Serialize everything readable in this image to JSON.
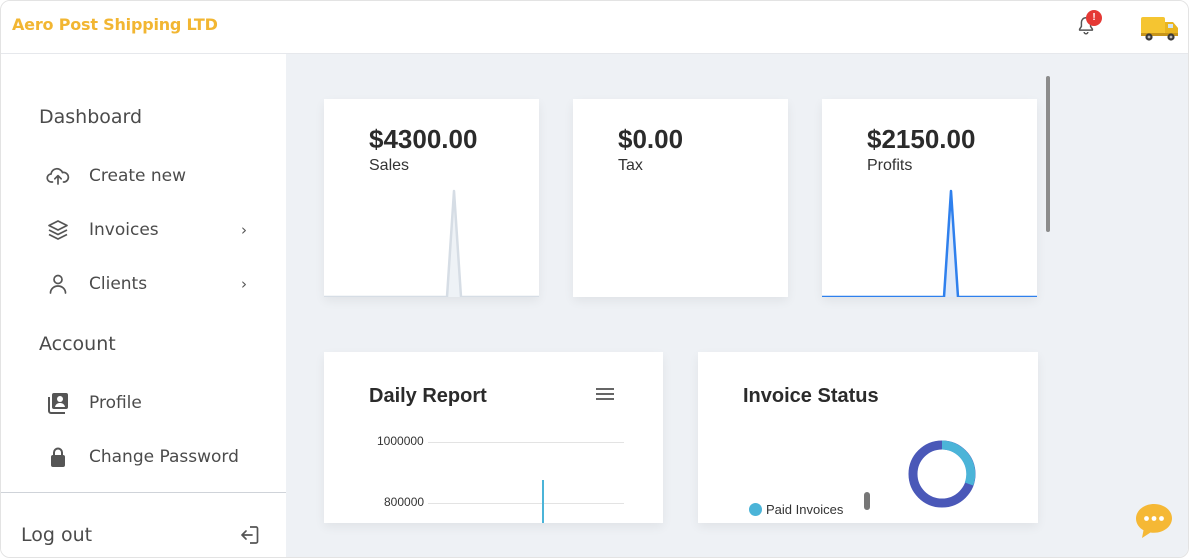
{
  "header": {
    "brand": "Aero Post Shipping LTD",
    "notification_count": "!",
    "brand_color": "#f2b632"
  },
  "sidebar": {
    "sections": [
      {
        "title": "Dashboard",
        "items": [
          {
            "label": "Create new",
            "icon": "cloud-upload-icon"
          },
          {
            "label": "Invoices",
            "icon": "layers-icon",
            "has_submenu": true
          },
          {
            "label": "Clients",
            "icon": "user-icon",
            "has_submenu": true
          }
        ]
      },
      {
        "title": "Account",
        "items": [
          {
            "label": "Profile",
            "icon": "profile-card-icon"
          },
          {
            "label": "Change Password",
            "icon": "lock-icon"
          }
        ]
      }
    ],
    "logout_label": "Log out",
    "chevron": "›"
  },
  "stats": [
    {
      "value": "$4300.00",
      "label": "Sales"
    },
    {
      "value": "$0.00",
      "label": "Tax"
    },
    {
      "value": "$2150.00",
      "label": "Profits"
    }
  ],
  "daily_report": {
    "title": "Daily Report",
    "menu_icon": "hamburger-menu-icon",
    "chart_data": {
      "type": "bar",
      "y_ticks": [
        "1000000",
        "800000"
      ],
      "series_color": "#4bb4d8"
    }
  },
  "invoice_status": {
    "title": "Invoice Status",
    "chart_data": {
      "type": "pie",
      "legend": [
        "Paid Invoices"
      ],
      "colors": [
        "#4bb4d8",
        "#4a58b8"
      ]
    }
  },
  "colors": {
    "accent": "#2f80ed",
    "page_bg": "#eef1f5"
  }
}
